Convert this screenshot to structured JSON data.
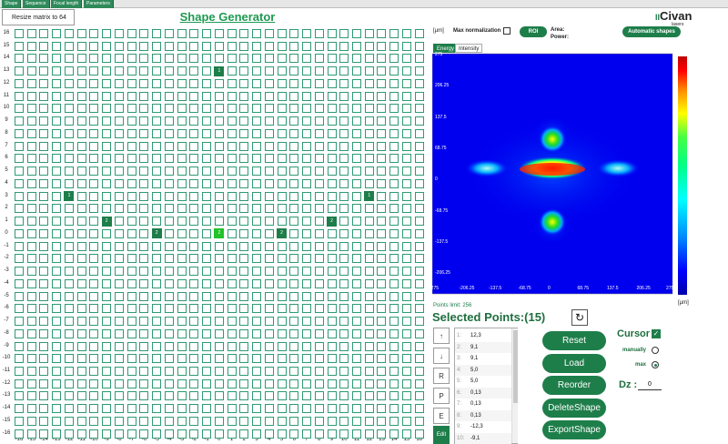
{
  "tabs": [
    "Shape",
    "Sequence",
    "Focal length",
    "Parameters"
  ],
  "resize_label": "Resize matrix to 64",
  "title": "Shape Generator",
  "y_labels": [
    "16",
    "15",
    "14",
    "13",
    "12",
    "11",
    "10",
    "9",
    "8",
    "7",
    "6",
    "5",
    "4",
    "3",
    "2",
    "1",
    "0",
    "-1",
    "-2",
    "-3",
    "-4",
    "-5",
    "-6",
    "-7",
    "-8",
    "-9",
    "-10",
    "-11",
    "-12",
    "-13",
    "-14",
    "-15",
    "-16"
  ],
  "x_labels": [
    "-16",
    "-15",
    "-14",
    "-13",
    "-12",
    "-11",
    "-10",
    "-9",
    "-8",
    "-7",
    "-6",
    "-5",
    "-4",
    "-3",
    "-2",
    "-1",
    "0",
    "1",
    "2",
    "3",
    "4",
    "5",
    "6",
    "7",
    "8",
    "9",
    "10",
    "11",
    "12",
    "13",
    "14",
    "15",
    "16"
  ],
  "grid_points": [
    {
      "x": 0,
      "y": 13,
      "label": "1"
    },
    {
      "x": -12,
      "y": 3,
      "label": "1"
    },
    {
      "x": 12,
      "y": 3,
      "label": "1"
    },
    {
      "x": -9,
      "y": 1,
      "label": "2"
    },
    {
      "x": 9,
      "y": 1,
      "label": "2"
    },
    {
      "x": -5,
      "y": 0,
      "label": "2"
    },
    {
      "x": 0,
      "y": 0,
      "label": "2"
    },
    {
      "x": 5,
      "y": 0,
      "label": "2"
    }
  ],
  "logo": {
    "name": "Civan",
    "sub": "lasers",
    "mark": "II"
  },
  "header": {
    "unit": "[µm]",
    "max_norm": "Max normalization",
    "roi": "ROI",
    "area": "Area:",
    "power": "Power:",
    "auto": "Automatic shapes"
  },
  "plot_tabs": [
    "Energy",
    "Intensity"
  ],
  "plot_unit": "[µm]",
  "plot_ticks_y": [
    "275",
    "206.25",
    "137.5",
    "68.75",
    "0",
    "-68.75",
    "-137.5",
    "-206.25"
  ],
  "plot_ticks_x": [
    "-275",
    "-206.25",
    "-137.5",
    "-68.75",
    "0",
    "68.75",
    "137.5",
    "206.25",
    "275"
  ],
  "points_limit": "Points limit: 256",
  "selected_title": "Selected Points:(15)",
  "side_buttons": [
    "↑",
    "↓",
    "R",
    "P",
    "E"
  ],
  "edit_label": "Edit",
  "points_list": [
    {
      "i": "1:",
      "v": "12,3"
    },
    {
      "i": "2:",
      "v": "9,1"
    },
    {
      "i": "3:",
      "v": "9,1"
    },
    {
      "i": "4:",
      "v": "5,0"
    },
    {
      "i": "5:",
      "v": "5,0"
    },
    {
      "i": "6:",
      "v": "0,13"
    },
    {
      "i": "7:",
      "v": "0,13"
    },
    {
      "i": "8:",
      "v": "0,13"
    },
    {
      "i": "9:",
      "v": "-12,3"
    },
    {
      "i": "10:",
      "v": "-9,1"
    }
  ],
  "actions": [
    "Reset",
    "Load",
    "Reorder",
    "DeleteShape",
    "ExportShape"
  ],
  "cursor": {
    "label": "Cursor",
    "manually": "manually",
    "max": "max"
  },
  "dz": {
    "label": "Dz :",
    "value": "0"
  },
  "colors": {
    "accent": "#1e7e4a",
    "grid": "#2f9a73",
    "title": "#1e9a52",
    "center": "#22c22a"
  }
}
